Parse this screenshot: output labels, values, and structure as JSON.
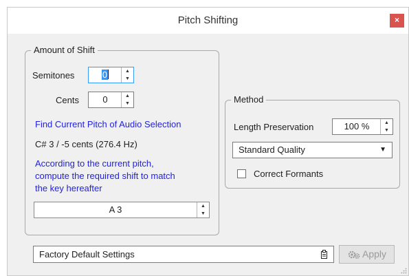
{
  "window": {
    "title": "Pitch Shifting",
    "close_glyph": "×"
  },
  "amount": {
    "legend": "Amount of Shift",
    "semitones": {
      "label": "Semitones",
      "value": "0"
    },
    "cents": {
      "label": "Cents",
      "value": "0"
    },
    "find_pitch_link": "Find Current Pitch of Audio Selection",
    "detected_pitch": "C# 3 / -5 cents (276.4 Hz)",
    "compute_link_lines": [
      "According to the current pitch,",
      "compute the required shift to match",
      "the key hereafter"
    ],
    "target_key": "A 3"
  },
  "method": {
    "legend": "Method",
    "length_preservation": {
      "label": "Length Preservation",
      "value": "100 %"
    },
    "quality": {
      "selected": "Standard Quality"
    },
    "correct_formants": {
      "label": "Correct Formants",
      "checked": false
    }
  },
  "footer": {
    "preset_value": "Factory Default Settings",
    "apply_label": "Apply",
    "apply_enabled": false
  },
  "icons": {
    "close": "close-icon",
    "spin_up": "spin-up-icon",
    "spin_down": "spin-down-icon",
    "dropdown": "chevron-down-icon",
    "preset_menu": "preset-menu-icon",
    "apply": "gears-icon",
    "resize": "resize-grip-icon"
  },
  "colors": {
    "link": "#2222dd",
    "close_button": "#d9534f",
    "focus_border": "#3399ff"
  }
}
